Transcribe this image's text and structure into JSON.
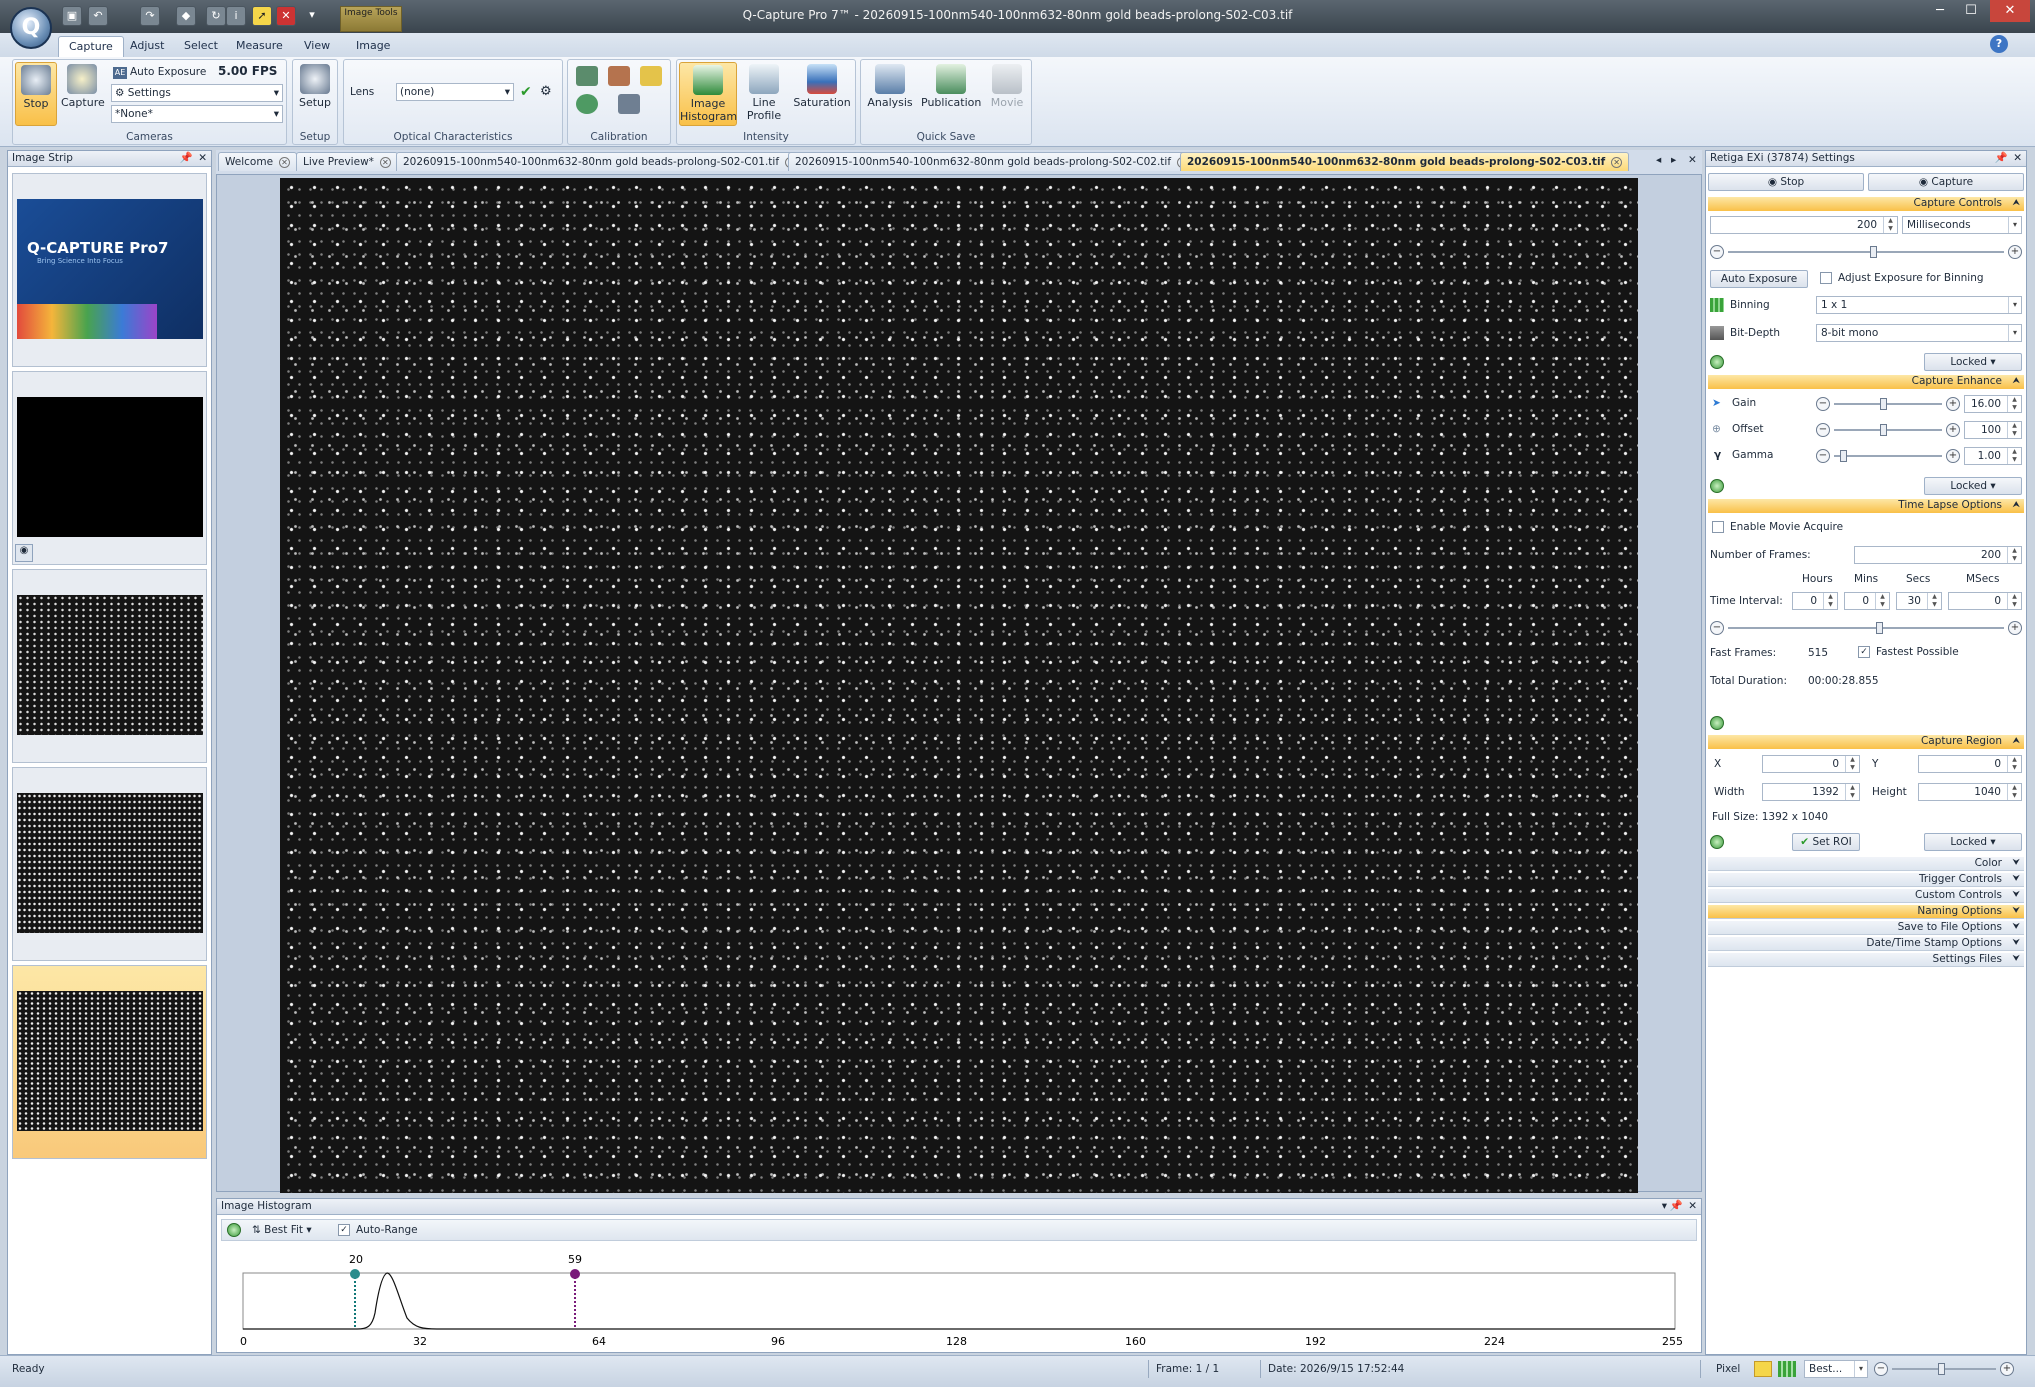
{
  "window": {
    "title": "Q-Capture Pro 7™ - 20260915-100nm540-100nm632-80nm gold beads-prolong-S02-C03.tif",
    "contextual_tab": "Image Tools",
    "app_button_letter": "Q"
  },
  "ribbon_tabs": [
    "Capture",
    "Adjust",
    "Select",
    "Measure",
    "View",
    "Image"
  ],
  "ribbon": {
    "cameras": {
      "stop_label": "Stop",
      "capture_label": "Capture",
      "auto_exposure_label": "Auto Exposure",
      "fps": "5.00 FPS",
      "settings_label": "Settings",
      "preset_value": "*None*",
      "group_label": "Cameras"
    },
    "setup": {
      "button_label": "Setup",
      "group_label": "Setup"
    },
    "optical": {
      "lens_label": "Lens",
      "lens_value": "(none)",
      "group_label": "Optical Characteristics"
    },
    "calibration": {
      "group_label": "Calibration"
    },
    "intensity": {
      "histogram_label": "Image Histogram",
      "line_profile_label": "Line Profile",
      "saturation_label": "Saturation",
      "group_label": "Intensity"
    },
    "quick_save": {
      "analysis_label": "Analysis",
      "publication_label": "Publication",
      "movie_label": "Movie",
      "group_label": "Quick Save"
    }
  },
  "image_strip": {
    "title": "Image Strip",
    "splash_brand": "Q-CAPTURE Pro7",
    "splash_tagline": "Bring Science Into Focus"
  },
  "doc_tabs": [
    {
      "label": "Welcome"
    },
    {
      "label": "Live Preview*"
    },
    {
      "label": "20260915-100nm540-100nm632-80nm gold beads-prolong-S02-C01.tif"
    },
    {
      "label": "20260915-100nm540-100nm632-80nm gold beads-prolong-S02-C02.tif"
    },
    {
      "label": "20260915-100nm540-100nm632-80nm  gold  beads-prolong-S02-C03.tif"
    }
  ],
  "histogram": {
    "title": "Image Histogram",
    "fit_label": "Best Fit",
    "auto_range_label": "Auto-Range",
    "low_marker": "20",
    "high_marker": "59",
    "ticks": [
      "0",
      "32",
      "64",
      "96",
      "128",
      "160",
      "192",
      "224",
      "255"
    ]
  },
  "settings": {
    "title": "Retiga EXi (37874) Settings",
    "stop_label": "Stop",
    "capture_label": "Capture",
    "capture_controls": {
      "header": "Capture Controls",
      "exposure_value": "200",
      "exposure_unit": "Milliseconds",
      "auto_exposure_btn": "Auto Exposure",
      "adjust_binning_label": "Adjust Exposure for Binning",
      "binning_label": "Binning",
      "binning_value": "1 x 1",
      "bitdepth_label": "Bit-Depth",
      "bitdepth_value": "8-bit mono",
      "locked_label": "Locked"
    },
    "capture_enhance": {
      "header": "Capture Enhance",
      "gain_label": "Gain",
      "gain_value": "16.00",
      "offset_label": "Offset",
      "offset_value": "100",
      "gamma_label": "Gamma",
      "gamma_value": "1.00",
      "locked_label": "Locked"
    },
    "time_lapse": {
      "header": "Time Lapse Options",
      "enable_label": "Enable Movie Acquire",
      "frames_label": "Number of Frames:",
      "frames_value": "200",
      "hours_label": "Hours",
      "mins_label": "Mins",
      "secs_label": "Secs",
      "msecs_label": "MSecs",
      "interval_label": "Time Interval:",
      "hours_value": "0",
      "mins_value": "0",
      "secs_value": "30",
      "msecs_value": "0",
      "fast_frames_label": "Fast Frames:",
      "fast_frames_value": "515",
      "fastest_label": "Fastest Possible",
      "total_duration_label": "Total Duration:",
      "total_duration_value": "00:00:28.855"
    },
    "capture_region": {
      "header": "Capture Region",
      "x_label": "X",
      "x_value": "0",
      "y_label": "Y",
      "y_value": "0",
      "width_label": "Width",
      "width_value": "1392",
      "height_label": "Height",
      "height_value": "1040",
      "full_size": "Full Size: 1392 x 1040",
      "set_roi_label": "Set ROI",
      "locked_label": "Locked"
    },
    "collapsed": [
      "Color",
      "Trigger Controls",
      "Custom Controls",
      "Naming Options",
      "Save to File Options",
      "Date/Time Stamp Options",
      "Settings Files"
    ]
  },
  "status": {
    "ready": "Ready",
    "frame": "Frame: 1 / 1",
    "date": "Date: 2026/9/15 17:52:44",
    "unit": "Pixel",
    "zoom": "Best..."
  }
}
